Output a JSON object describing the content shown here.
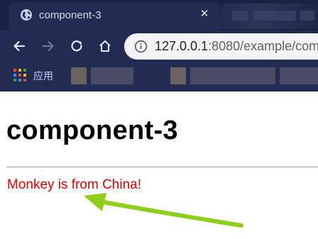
{
  "browser": {
    "tab": {
      "title": "component-3",
      "close_glyph": "✕"
    },
    "toolbar": {
      "back_icon": "arrow-left-icon",
      "forward_icon": "arrow-right-icon",
      "reload_icon": "reload-icon",
      "home_icon": "home-icon",
      "url_host": "127.0.0.1",
      "url_rest": ":8080/example/com"
    },
    "bookmarks": {
      "apps_label": "应用"
    }
  },
  "page": {
    "heading": "component-3",
    "message": "Monkey is from China!"
  },
  "colors": {
    "chrome": "#1f2a4c",
    "message": "#dd0000",
    "annotation_arrow": "#8fcf1a"
  }
}
